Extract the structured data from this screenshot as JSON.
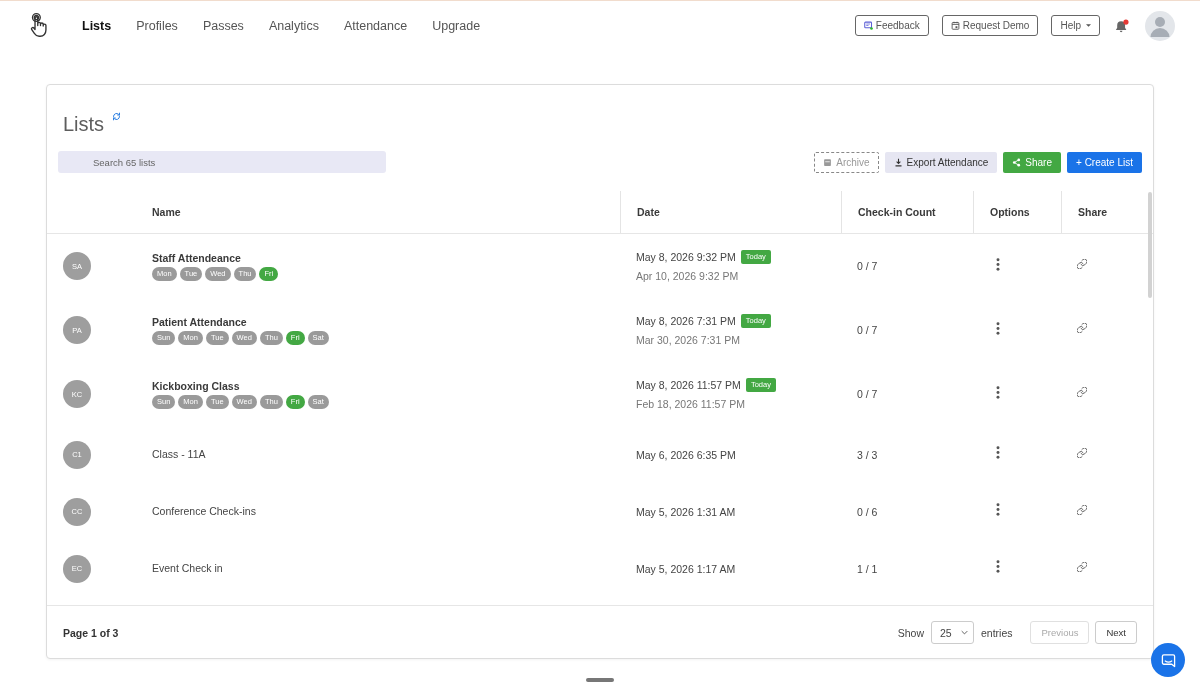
{
  "nav": {
    "items": [
      {
        "label": "Lists",
        "selected": true
      },
      {
        "label": "Profiles",
        "selected": false
      },
      {
        "label": "Passes",
        "selected": false
      },
      {
        "label": "Analytics",
        "selected": false
      },
      {
        "label": "Attendance",
        "selected": false
      },
      {
        "label": "Upgrade",
        "selected": false
      }
    ]
  },
  "top_bar": {
    "feedback": "Feedback",
    "request_demo": "Request Demo",
    "help": "Help",
    "notifications": {
      "unread": true
    }
  },
  "lists": {
    "title": "Lists",
    "search": {
      "placeholder": "Search 65 lists"
    },
    "actions": [
      {
        "kind": "archive",
        "label": "Archive",
        "disabled": true
      },
      {
        "kind": "export",
        "label": "Export Attendance",
        "disabled": false
      },
      {
        "kind": "share",
        "label": "Share",
        "disabled": false
      },
      {
        "kind": "create",
        "label": "+ Create List",
        "disabled": false
      }
    ]
  },
  "table": {
    "columns": [
      "Name",
      "Date",
      "Check-in Count",
      "Options",
      "Share"
    ],
    "rows": [
      {
        "initials": "SA",
        "name": "Staff Attendeance",
        "kind": "recurring",
        "days": [
          {
            "label": "Mon",
            "selected": false
          },
          {
            "label": "Tue",
            "selected": false
          },
          {
            "label": "Wed",
            "selected": false
          },
          {
            "label": "Thu",
            "selected": false
          },
          {
            "label": "Fri",
            "selected": true
          }
        ],
        "date": "May 8, 2026 9:32 PM",
        "badge": "Today",
        "second_date": "Apr 10, 2026 9:32 PM",
        "count": "0 / 7"
      },
      {
        "initials": "PA",
        "name": "Patient Attendance",
        "kind": "recurring",
        "days": [
          {
            "label": "Sun",
            "selected": false
          },
          {
            "label": "Mon",
            "selected": false
          },
          {
            "label": "Tue",
            "selected": false
          },
          {
            "label": "Wed",
            "selected": false
          },
          {
            "label": "Thu",
            "selected": false
          },
          {
            "label": "Fri",
            "selected": true
          },
          {
            "label": "Sat",
            "selected": false
          }
        ],
        "date": "May 8, 2026 7:31 PM",
        "badge": "Today",
        "second_date": "Mar 30, 2026 7:31 PM",
        "count": "0 / 7"
      },
      {
        "initials": "KC",
        "name": "Kickboxing Class",
        "kind": "recurring",
        "days": [
          {
            "label": "Sun",
            "selected": false
          },
          {
            "label": "Mon",
            "selected": false
          },
          {
            "label": "Tue",
            "selected": false
          },
          {
            "label": "Wed",
            "selected": false
          },
          {
            "label": "Thu",
            "selected": false
          },
          {
            "label": "Fri",
            "selected": true
          },
          {
            "label": "Sat",
            "selected": false
          }
        ],
        "date": "May 8, 2026 11:57 PM",
        "badge": "Today",
        "second_date": "Feb 18, 2026 11:57 PM",
        "count": "0 / 7"
      },
      {
        "initials": "C1",
        "name": "Class - 11A",
        "kind": "single",
        "date": "May 6, 2026 6:35 PM",
        "count": "3 / 3"
      },
      {
        "initials": "CC",
        "name": "Conference Check-ins",
        "kind": "single",
        "date": "May 5, 2026 1:31 AM",
        "count": "0 / 6"
      },
      {
        "initials": "EC",
        "name": "Event Check in",
        "kind": "single",
        "date": "May 5, 2026 1:17 AM",
        "count": "1 / 1"
      }
    ]
  },
  "footer": {
    "page_info": "Page 1 of 3",
    "show_label": "Show",
    "page_size": "25",
    "entries_label": "entries",
    "previous": {
      "label": "Previous",
      "disabled": true
    },
    "next": {
      "label": "Next",
      "disabled": false
    }
  }
}
